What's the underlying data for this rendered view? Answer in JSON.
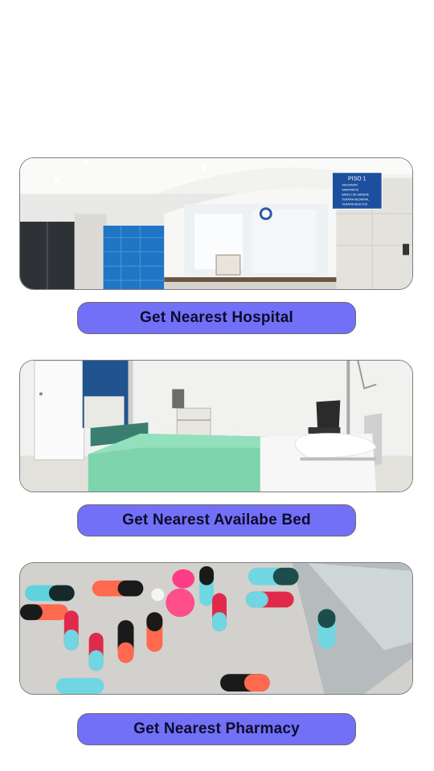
{
  "buttons": {
    "hospital": "Get Nearest Hospital",
    "bed": "Get Nearest Availabe Bed",
    "pharmacy": "Get Nearest Pharmacy"
  },
  "hospital_sign": {
    "title": "PISO 1",
    "items": [
      "ASCENSOR",
      "SANITARIOS",
      "BANCO DE SANGRE",
      "TERAPIA NEONATAL",
      "TERAPIA ADULTOS"
    ]
  },
  "colors": {
    "button_bg": "#7270f7",
    "button_text": "#0c0c2a",
    "card_border": "#7d7d7d"
  }
}
